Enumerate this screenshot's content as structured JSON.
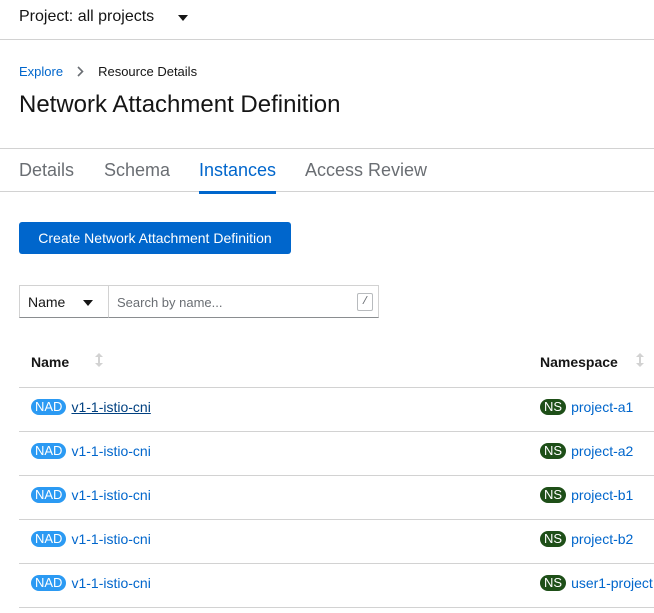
{
  "project": {
    "label": "Project: all projects"
  },
  "breadcrumb": {
    "link": "Explore",
    "current": "Resource Details"
  },
  "page": {
    "title": "Network Attachment Definition"
  },
  "tabs": [
    {
      "label": "Details"
    },
    {
      "label": "Schema"
    },
    {
      "label": "Instances",
      "active": true
    },
    {
      "label": "Access Review"
    }
  ],
  "actions": {
    "create_label": "Create Network Attachment Definition"
  },
  "filter": {
    "selected": "Name",
    "placeholder": "Search by name...",
    "shortcut": "/"
  },
  "table": {
    "columns": {
      "name": "Name",
      "namespace": "Namespace"
    },
    "badges": {
      "resource": "NAD",
      "namespace": "NS"
    },
    "rows": [
      {
        "name": "v1-1-istio-cni",
        "namespace": "project-a1"
      },
      {
        "name": "v1-1-istio-cni",
        "namespace": "project-a2"
      },
      {
        "name": "v1-1-istio-cni",
        "namespace": "project-b1"
      },
      {
        "name": "v1-1-istio-cni",
        "namespace": "project-b2"
      },
      {
        "name": "v1-1-istio-cni",
        "namespace": "user1-project"
      }
    ]
  },
  "colors": {
    "accent": "#0066cc",
    "nad_badge": "#2b9af3",
    "ns_badge": "#1e4f18",
    "border": "#d2d2d2"
  }
}
